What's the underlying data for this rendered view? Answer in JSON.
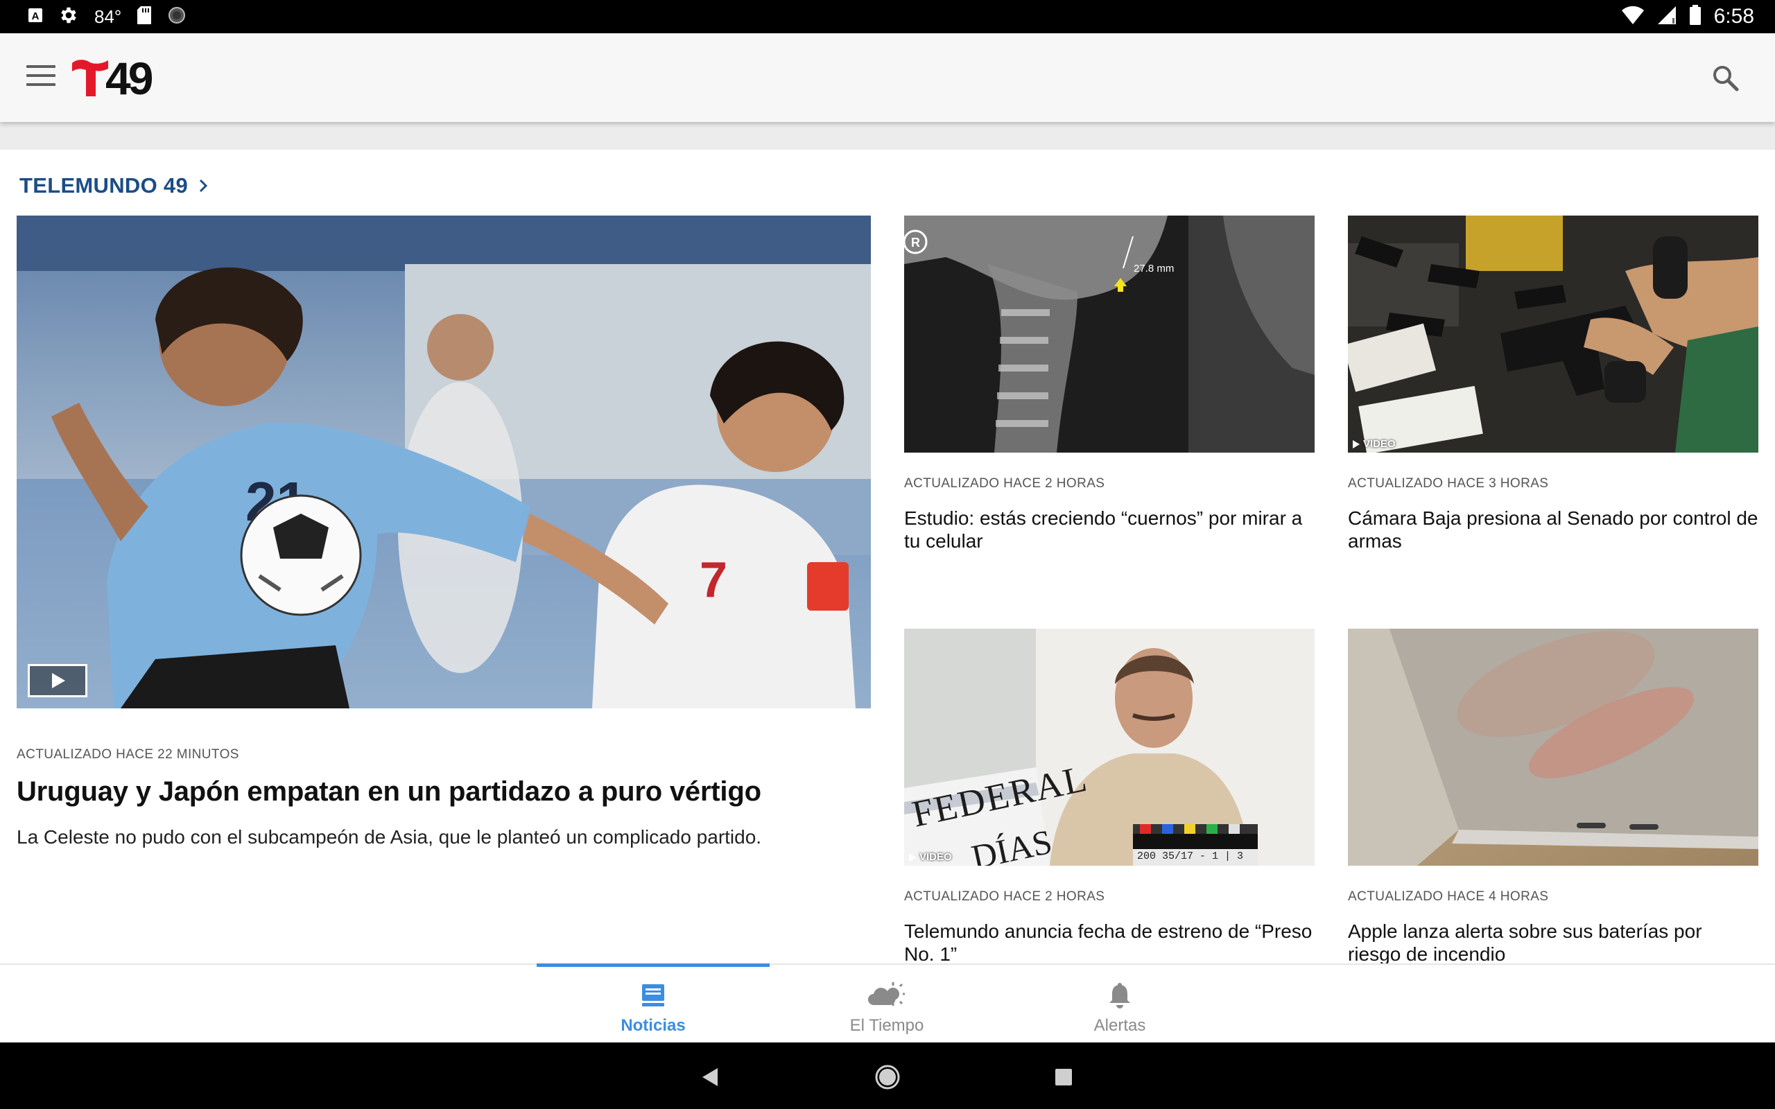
{
  "status_bar": {
    "temperature": "84°",
    "time": "6:58",
    "icons": [
      "app-a-icon",
      "gear-icon",
      "sd-card-icon",
      "circle-icon",
      "wifi-icon",
      "signal-icon",
      "battery-icon"
    ]
  },
  "app_bar": {
    "logo_number": "49",
    "icons": [
      "menu-icon",
      "telemundo-t-logo",
      "search-icon"
    ]
  },
  "section": {
    "title": "TELEMUNDO 49"
  },
  "main_story": {
    "meta": "ACTUALIZADO HACE 22 MINUTOS",
    "title": "Uruguay y Japón empatan en un partidazo a puro vértigo",
    "description": "La Celeste no pudo con el subcampeón de Asia, que le planteó un complicado partido.",
    "image": "soccer-match-photo",
    "badge": "play-video-icon"
  },
  "cards": [
    {
      "meta": "ACTUALIZADO HACE 2 HORAS",
      "title": "Estudio: estás creciendo “cuernos” por mirar a tu celular",
      "image_label": "27.8 mm",
      "image": "xray-skull-photo"
    },
    {
      "meta": "ACTUALIZADO HACE 3 HORAS",
      "title": "Cámara Baja presiona al Senado por control de armas",
      "video_tag": "VIDEO",
      "image": "handguns-photo"
    },
    {
      "meta": "ACTUALIZADO HACE 2 HORAS",
      "title": "Telemundo anuncia fecha de estreno de “Preso No. 1”",
      "video_tag": "VIDEO",
      "image_text_1": "FEDERAL",
      "image_text_2": "DÍAS",
      "image_text_3": "200 35/17 - 1 | 3",
      "image": "actor-with-clapperboard-photo"
    },
    {
      "meta": "ACTUALIZADO HACE 4 HORAS",
      "title": "Apple lanza alerta sobre sus baterías por riesgo de incendio",
      "image": "laptop-trackpad-photo"
    }
  ],
  "bottom_nav": {
    "items": [
      {
        "label": "Noticias",
        "icon": "news-icon",
        "active": true
      },
      {
        "label": "El Tiempo",
        "icon": "weather-icon",
        "active": false
      },
      {
        "label": "Alertas",
        "icon": "bell-icon",
        "active": false
      }
    ]
  },
  "system_nav": {
    "icons": [
      "back-icon",
      "home-icon",
      "recents-icon"
    ]
  },
  "colors": {
    "accent": "#3b8ee0",
    "section_title": "#1b4d86",
    "logo_red": "#e4182b"
  }
}
